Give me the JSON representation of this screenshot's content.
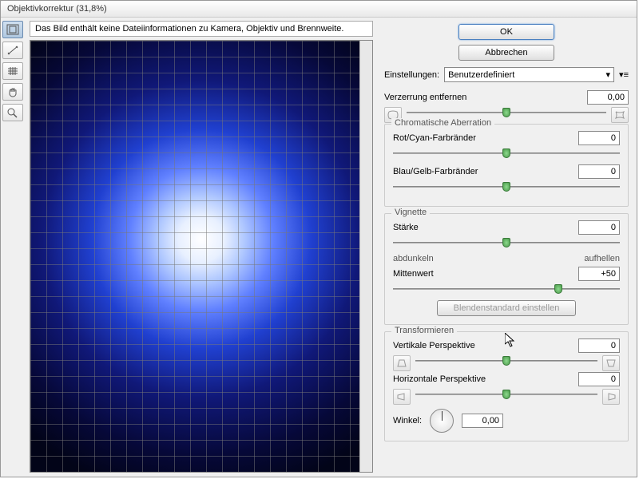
{
  "title": "Objektivkorrektur (31,8%)",
  "info": "Das Bild enthält keine Dateiinformationen zu Kamera, Objektiv und Brennweite.",
  "buttons": {
    "ok": "OK",
    "cancel": "Abbrechen"
  },
  "settings": {
    "label": "Einstellungen:",
    "value": "Benutzerdefiniert"
  },
  "distortion": {
    "label": "Verzerrung entfernen",
    "value": "0,00",
    "pos": 50
  },
  "chroma": {
    "title": "Chromatische Aberration",
    "redcyan": {
      "label": "Rot/Cyan-Farbränder",
      "value": "0",
      "pos": 50
    },
    "blueyellow": {
      "label": "Blau/Gelb-Farbränder",
      "value": "0",
      "pos": 50
    }
  },
  "vignette": {
    "title": "Vignette",
    "strength": {
      "label": "Stärke",
      "value": "0",
      "pos": 50
    },
    "darken": "abdunkeln",
    "lighten": "aufhellen",
    "midpoint": {
      "label": "Mittenwert",
      "value": "+50",
      "pos": 73
    },
    "defaultbtn": "Blendenstandard einstellen"
  },
  "transform": {
    "title": "Transformieren",
    "vpersp": {
      "label": "Vertikale Perspektive",
      "value": "0",
      "pos": 50
    },
    "hpersp": {
      "label": "Horizontale Perspektive",
      "value": "0",
      "pos": 50
    },
    "angle": {
      "label": "Winkel:",
      "value": "0,00"
    }
  }
}
